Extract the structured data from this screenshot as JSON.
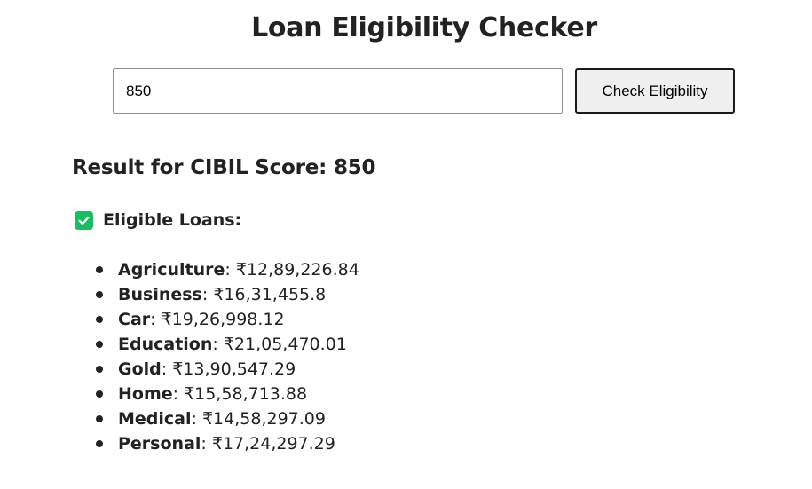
{
  "title": "Loan Eligibility Checker",
  "form": {
    "score_value": "850",
    "button_label": "Check Eligibility"
  },
  "result": {
    "heading": "Result for CIBIL Score: 850",
    "eligible_label": "Eligible Loans:",
    "check_icon": "check-square-icon",
    "accent_color": "#16c060",
    "loans": [
      {
        "name": "Agriculture",
        "amount": "₹12,89,226.84"
      },
      {
        "name": "Business",
        "amount": "₹16,31,455.8"
      },
      {
        "name": "Car",
        "amount": "₹19,26,998.12"
      },
      {
        "name": "Education",
        "amount": "₹21,05,470.01"
      },
      {
        "name": "Gold",
        "amount": "₹13,90,547.29"
      },
      {
        "name": "Home",
        "amount": "₹15,58,713.88"
      },
      {
        "name": "Medical",
        "amount": "₹14,58,297.09"
      },
      {
        "name": "Personal",
        "amount": "₹17,24,297.29"
      }
    ]
  }
}
